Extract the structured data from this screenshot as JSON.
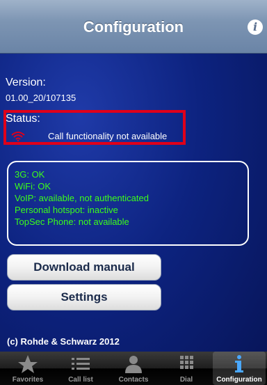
{
  "navbar": {
    "title": "Configuration",
    "info_icon": "info-icon"
  },
  "version": {
    "label": "Version:",
    "value": "01.00_20/107135"
  },
  "status": {
    "label": "Status:",
    "text": "Call functionality not available",
    "icon": "wifi-off-icon",
    "icon_color": "#e0001a",
    "highlight_color": "#e0001a"
  },
  "connectivity": [
    "3G: OK",
    "WiFi: OK",
    "VoIP: available, not authenticated",
    "Personal hotspot: inactive",
    "TopSec Phone: not available"
  ],
  "buttons": {
    "download_manual": "Download manual",
    "settings": "Settings"
  },
  "footer": {
    "copyright": "(c) Rohde & Schwarz 2012"
  },
  "tabs": [
    {
      "label": "Favorites",
      "icon": "star-icon",
      "active": false
    },
    {
      "label": "Call list",
      "icon": "list-icon",
      "active": false
    },
    {
      "label": "Contacts",
      "icon": "person-icon",
      "active": false
    },
    {
      "label": "Dial",
      "icon": "keypad-icon",
      "active": false
    },
    {
      "label": "Configuration",
      "icon": "info-icon",
      "active": true
    }
  ],
  "colors": {
    "text_green": "#3cff1a"
  }
}
